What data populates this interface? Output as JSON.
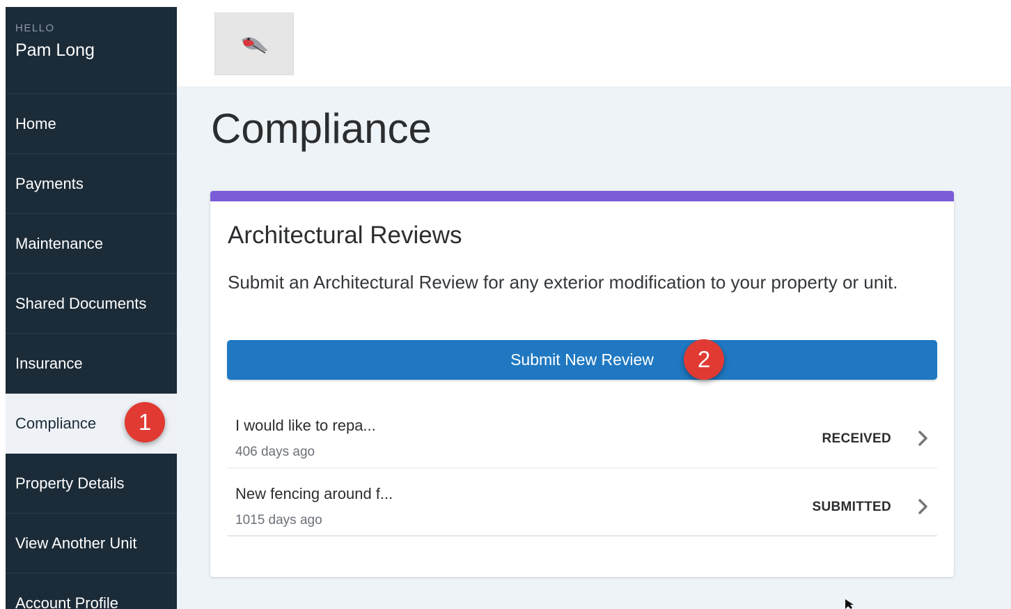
{
  "sidebar": {
    "greeting": "HELLO",
    "user_name": "Pam Long",
    "items": [
      {
        "label": "Home"
      },
      {
        "label": "Payments"
      },
      {
        "label": "Maintenance"
      },
      {
        "label": "Shared Documents"
      },
      {
        "label": "Insurance"
      },
      {
        "label": "Compliance",
        "active": true
      },
      {
        "label": "Property Details"
      },
      {
        "label": "View Another Unit"
      },
      {
        "label": "Account Profile"
      }
    ]
  },
  "header": {
    "logo_icon": "bird-logo-icon"
  },
  "main": {
    "page_title": "Compliance",
    "card": {
      "title": "Architectural Reviews",
      "description": "Submit an Architectural Review for any exterior modification to your property or unit.",
      "submit_label": "Submit New Review",
      "accent_color": "#7a5cd6",
      "reviews": [
        {
          "title": "I would like to repa...",
          "age": "406 days ago",
          "status": "RECEIVED"
        },
        {
          "title": "New fencing around f...",
          "age": "1015 days ago",
          "status": "SUBMITTED"
        }
      ]
    }
  },
  "annotations": [
    {
      "number": "1",
      "target": "Compliance"
    },
    {
      "number": "2",
      "target": "Submit New Review"
    }
  ],
  "colors": {
    "sidebar_bg": "#1b2b38",
    "button_blue": "#1f78c1",
    "marker_red": "#e03a32"
  }
}
